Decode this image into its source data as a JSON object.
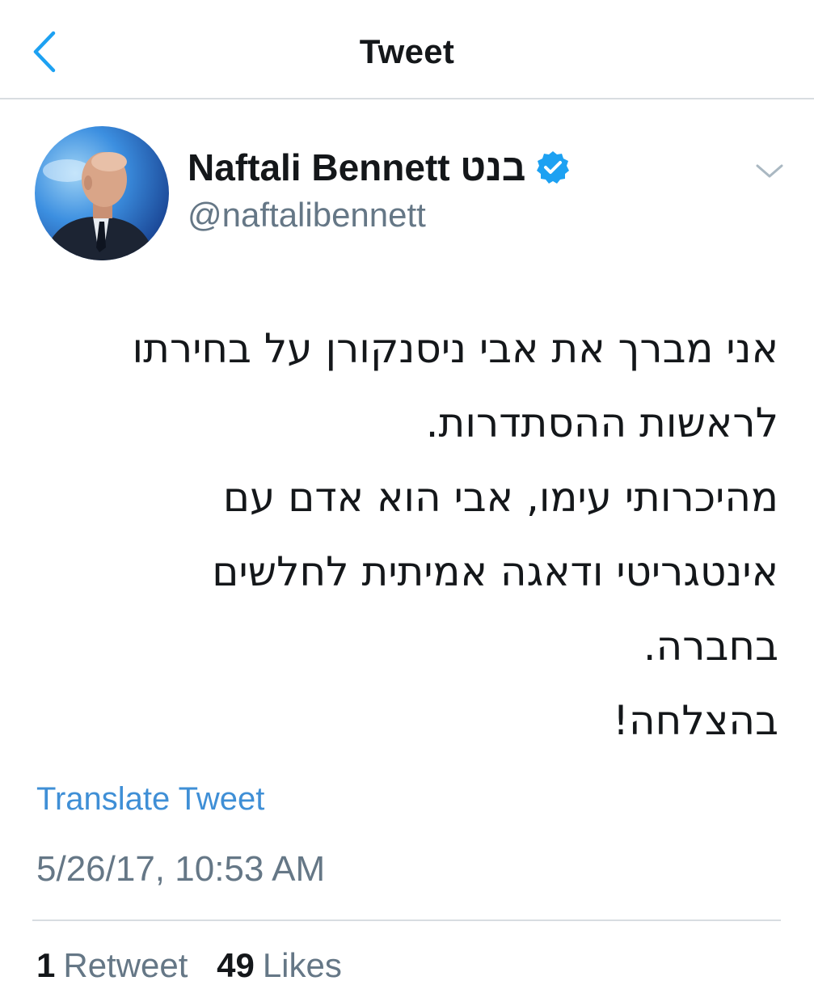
{
  "header": {
    "title": "Tweet",
    "back_icon": "chevron-left-icon"
  },
  "colors": {
    "accent": "#1da1f2",
    "link": "#3f8fd6",
    "secondary_text": "#657786",
    "divider": "#d8dde1"
  },
  "author": {
    "name": "Naftali Bennett בנט",
    "handle": "@naftalibennett",
    "verified": true
  },
  "tweet": {
    "lines": [
      "אני מברך את אבי ניסנקורן על בחירתו",
      "לראשות ההסתדרות.",
      "מהיכרותי עימו, אבי הוא אדם עם",
      "אינטגריטי ודאגה אמיתית לחלשים",
      "בחברה.",
      "בהצלחה!"
    ],
    "translate_label": "Translate Tweet",
    "timestamp": "5/26/17, 10:53 AM"
  },
  "stats": {
    "retweets_count": "1",
    "retweets_label": "Retweet",
    "likes_count": "49",
    "likes_label": "Likes"
  }
}
